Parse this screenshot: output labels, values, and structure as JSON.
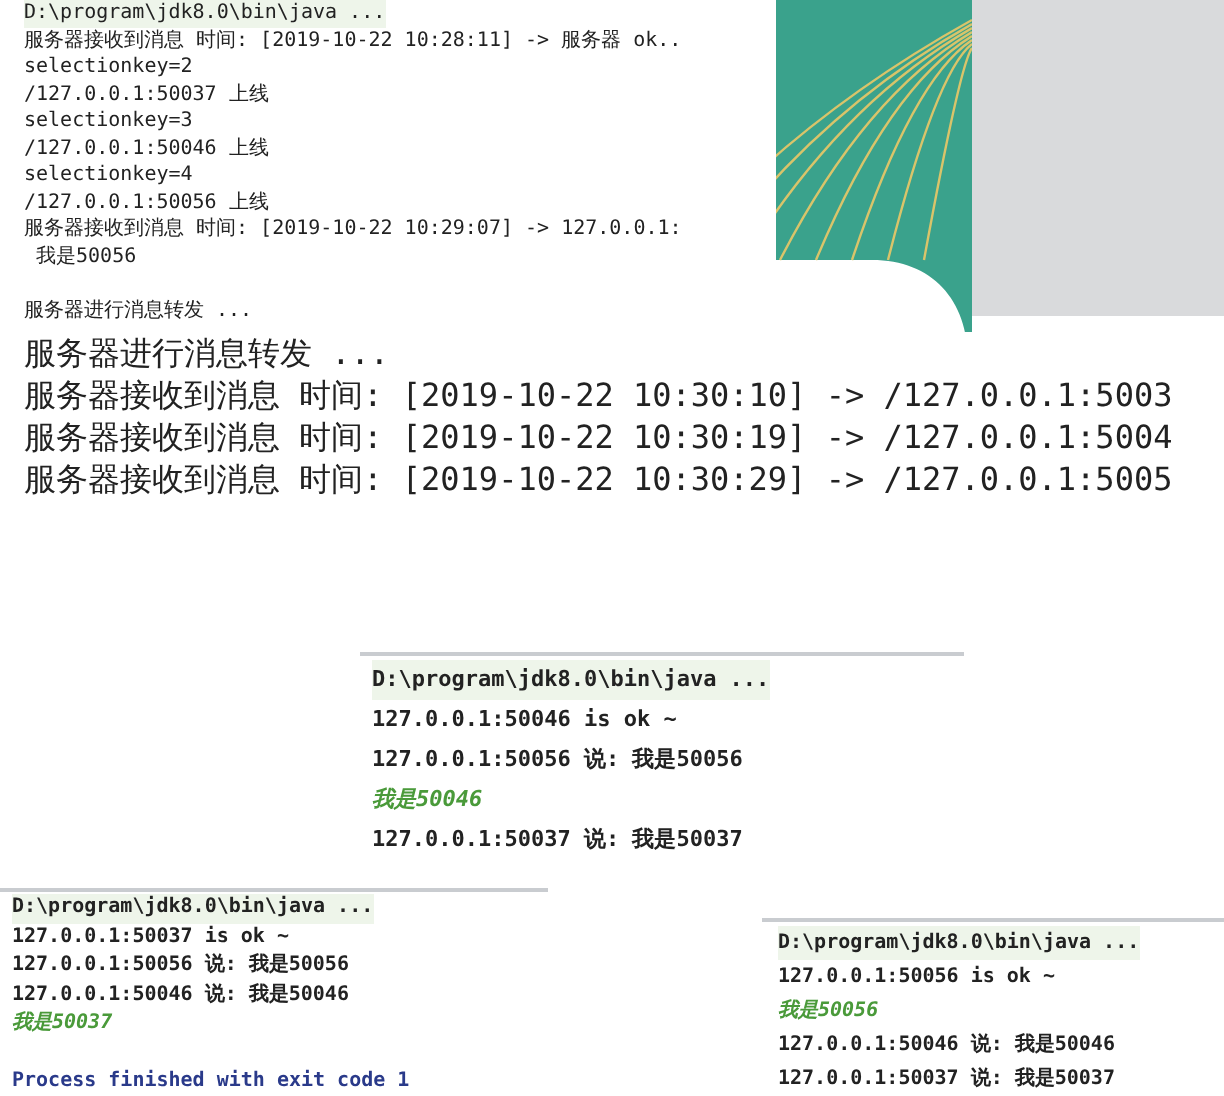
{
  "consoles": [
    {
      "lines": [
        {
          "kind": "command",
          "text": "D:\\program\\jdk8.0\\bin\\java ..."
        },
        {
          "kind": "output",
          "text": "服务器接收到消息 时间: [2019-10-22 10:28:11] -> 服务器 ok.."
        },
        {
          "kind": "output",
          "text": "selectionkey=2"
        },
        {
          "kind": "output",
          "text": "/127.0.0.1:50037 上线"
        },
        {
          "kind": "output",
          "text": "selectionkey=3"
        },
        {
          "kind": "output",
          "text": "/127.0.0.1:50046 上线"
        },
        {
          "kind": "output",
          "text": "selectionkey=4"
        },
        {
          "kind": "output",
          "text": "/127.0.0.1:50056 上线"
        },
        {
          "kind": "output",
          "text": "服务器接收到消息 时间: [2019-10-22 10:29:07] -> 127.0.0.1:"
        },
        {
          "kind": "output",
          "text": " 我是50056"
        },
        {
          "kind": "blank"
        },
        {
          "kind": "output",
          "text": "服务器进行消息转发 ..."
        }
      ]
    },
    {
      "lines": [
        {
          "kind": "output",
          "text": "服务器进行消息转发 ..."
        },
        {
          "kind": "output",
          "text": "服务器接收到消息 时间: [2019-10-22 10:30:10] -> /127.0.0.1:5003"
        },
        {
          "kind": "output",
          "text": "服务器接收到消息 时间: [2019-10-22 10:30:19] -> /127.0.0.1:5004"
        },
        {
          "kind": "output",
          "text": "服务器接收到消息 时间: [2019-10-22 10:30:29] -> /127.0.0.1:5005"
        }
      ]
    },
    {
      "lines": [
        {
          "kind": "command",
          "text": "D:\\program\\jdk8.0\\bin\\java ..."
        },
        {
          "kind": "output",
          "text": "127.0.0.1:50046 is ok ~"
        },
        {
          "kind": "output",
          "text": "127.0.0.1:50056 说: 我是50056"
        },
        {
          "kind": "input",
          "text": "我是50046"
        },
        {
          "kind": "output",
          "text": "127.0.0.1:50037 说: 我是50037"
        }
      ]
    },
    {
      "lines": [
        {
          "kind": "command",
          "text": "D:\\program\\jdk8.0\\bin\\java ..."
        },
        {
          "kind": "output",
          "text": "127.0.0.1:50037 is ok ~"
        },
        {
          "kind": "output",
          "text": "127.0.0.1:50056 说: 我是50056"
        },
        {
          "kind": "output",
          "text": "127.0.0.1:50046 说: 我是50046"
        },
        {
          "kind": "input",
          "text": "我是50037"
        },
        {
          "kind": "blank"
        },
        {
          "kind": "exit",
          "text": "Process finished with exit code 1"
        }
      ]
    },
    {
      "lines": [
        {
          "kind": "command",
          "text": "D:\\program\\jdk8.0\\bin\\java ..."
        },
        {
          "kind": "output",
          "text": "127.0.0.1:50056 is ok ~"
        },
        {
          "kind": "input",
          "text": "我是50056"
        },
        {
          "kind": "output",
          "text": "127.0.0.1:50046 说: 我是50046"
        },
        {
          "kind": "output",
          "text": "127.0.0.1:50037 说: 我是50037"
        }
      ]
    }
  ]
}
